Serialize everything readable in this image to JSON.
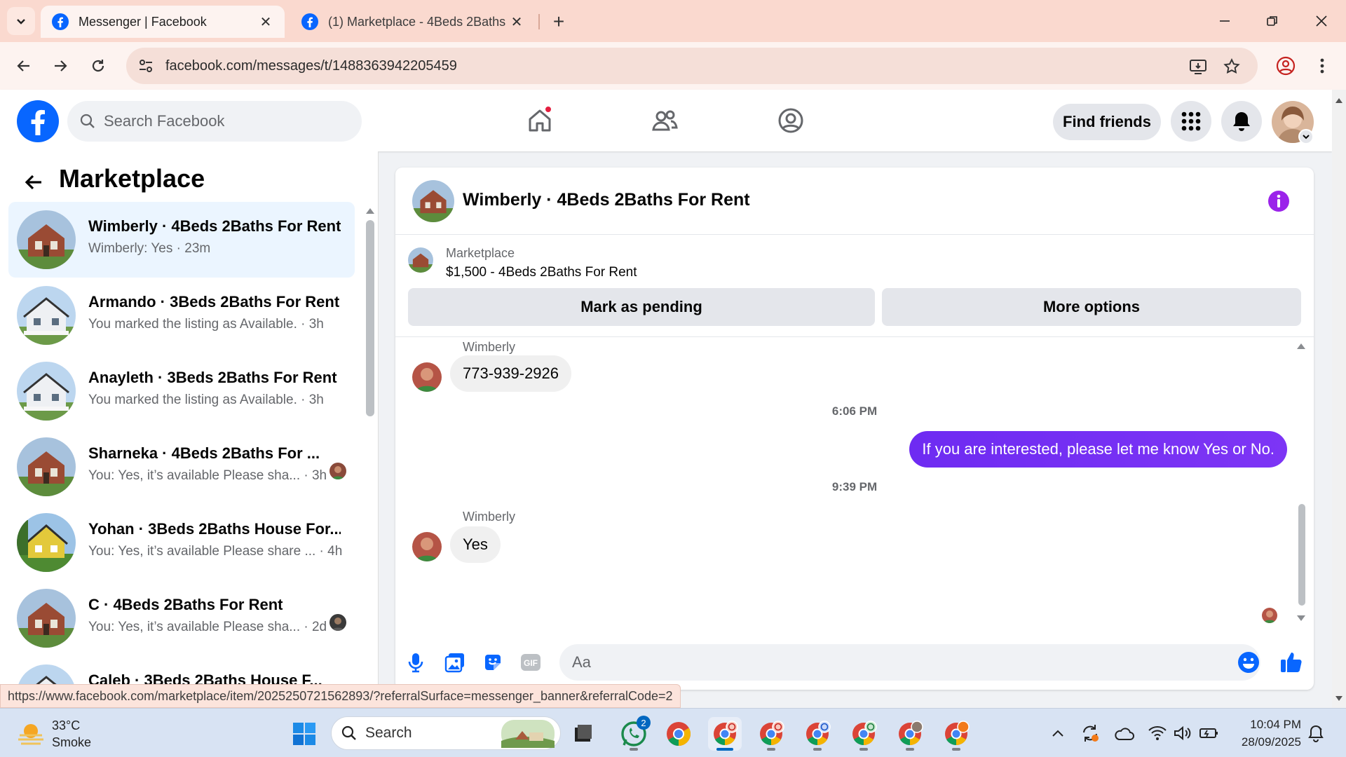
{
  "browser": {
    "tabs": [
      {
        "title": "Messenger | Facebook",
        "active": true
      },
      {
        "title": "(1) Marketplace - 4Beds 2Baths",
        "active": false
      }
    ],
    "url": "facebook.com/messages/t/1488363942205459"
  },
  "fb": {
    "search_placeholder": "Search Facebook",
    "find_friends": "Find friends"
  },
  "sidebar": {
    "title": "Marketplace",
    "conversations": [
      {
        "name": "Wimberly · 4Beds 2Baths For Rent",
        "snippet": "Wimberly: Yes · 23m",
        "selected": true
      },
      {
        "name": "Armando · 3Beds 2Baths For Rent",
        "snippet": "You marked the listing as Available. · 3h"
      },
      {
        "name": "Anayleth · 3Beds 2Baths For Rent",
        "snippet": "You marked the listing as Available. · 3h"
      },
      {
        "name": "Sharneka · 4Beds 2Baths For ...",
        "snippet": "You: Yes, it’s available Please sha... · 3h"
      },
      {
        "name": "Yohan · 3Beds 2Baths House For...",
        "snippet": "You: Yes, it’s available Please share ... · 4h"
      },
      {
        "name": "C · 4Beds 2Baths For Rent",
        "snippet": "You: Yes, it’s available Please sha... · 2d"
      },
      {
        "name": "Caleb · 3Beds 2Baths House F...",
        "snippet": ""
      }
    ]
  },
  "chat": {
    "title": "Wimberly · 4Beds 2Baths For Rent",
    "banner_label": "Marketplace",
    "banner_price": "$1,500 - 4Beds 2Baths For Rent",
    "mark_pending": "Mark as pending",
    "more_options": "More options",
    "messages": [
      {
        "sender": "Wimberly",
        "text": "773-939-2926",
        "dir": "in"
      },
      {
        "timestamp": "6:06 PM"
      },
      {
        "text": "If you are interested, please let me know Yes or No.",
        "dir": "out"
      },
      {
        "timestamp": "9:39 PM"
      },
      {
        "sender": "Wimberly",
        "text": "Yes",
        "dir": "in"
      }
    ],
    "composer_placeholder": "Aa"
  },
  "status_url": "https://www.facebook.com/marketplace/item/2025250721562893/?referralSurface=messenger_banner&referralCode=2",
  "taskbar": {
    "temperature": "33°C",
    "condition": "Smoke",
    "search_label": "Search",
    "whatsapp_badge": "2",
    "time": "10:04 PM",
    "date": "28/09/2025"
  },
  "colors": {
    "fb_blue": "#0866ff",
    "messenger_purple": "#7b2ff7",
    "tab_bar": "#fad9cf",
    "selected_conv": "#ebf5ff"
  }
}
